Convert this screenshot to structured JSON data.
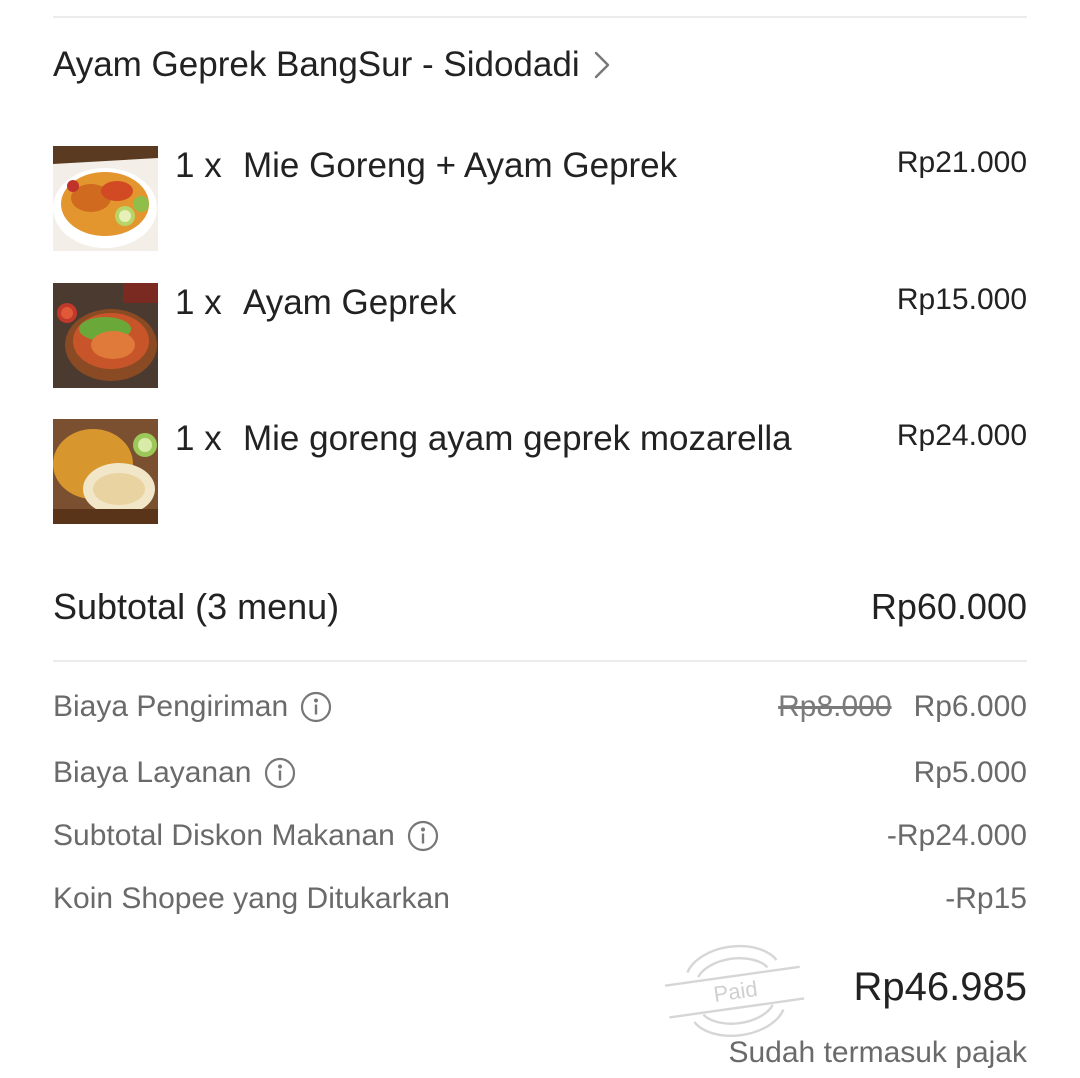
{
  "store": {
    "name": "Ayam Geprek BangSur - Sidodadi"
  },
  "items": [
    {
      "qty": "1 x",
      "name": "Mie Goreng + Ayam Geprek",
      "price": "Rp21.000"
    },
    {
      "qty": "1 x",
      "name": "Ayam Geprek",
      "price": "Rp15.000"
    },
    {
      "qty": "1 x",
      "name": "Mie goreng ayam geprek mozarella",
      "price": "Rp24.000"
    }
  ],
  "subtotal": {
    "label": "Subtotal (3 menu)",
    "value": "Rp60.000"
  },
  "fees": [
    {
      "label": "Biaya Pengiriman",
      "original": "Rp8.000",
      "value": "Rp6.000"
    },
    {
      "label": "Biaya Layanan",
      "value": "Rp5.000"
    },
    {
      "label": "Subtotal Diskon Makanan",
      "value": "-Rp24.000"
    },
    {
      "label": "Koin Shopee yang Ditukarkan",
      "value": "-Rp15"
    }
  ],
  "total": {
    "value": "Rp46.985",
    "tax_note": "Sudah termasuk pajak"
  },
  "stamp": {
    "text": "Paid"
  }
}
